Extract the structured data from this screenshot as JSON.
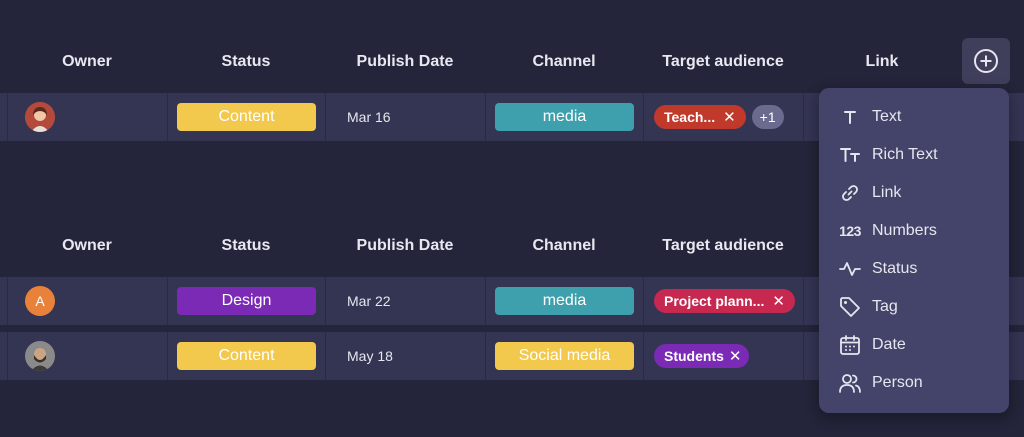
{
  "tables": [
    {
      "headers": [
        "Owner",
        "Status",
        "Publish Date",
        "Channel",
        "Target audience",
        "Link"
      ],
      "rows": [
        {
          "owner_avatar": "",
          "status": "Content",
          "publish_date": "Mar 16",
          "channel": "media",
          "audience_tag": "Teach...",
          "audience_more": "+1"
        }
      ]
    },
    {
      "headers": [
        "Owner",
        "Status",
        "Publish Date",
        "Channel",
        "Target audience"
      ],
      "rows": [
        {
          "owner_avatar": "A",
          "status": "Design",
          "publish_date": "Mar 22",
          "channel": "media",
          "audience_tag": "Project plann..."
        },
        {
          "owner_avatar": "",
          "status": "Content",
          "publish_date": "May 18",
          "channel": "Social media",
          "audience_tag": "Students"
        }
      ]
    }
  ],
  "tag_remove_glyph": "✕",
  "column_menu": {
    "items": [
      {
        "label": "Text",
        "icon": "text-icon"
      },
      {
        "label": "Rich Text",
        "icon": "rich-text-icon"
      },
      {
        "label": "Link",
        "icon": "link-icon"
      },
      {
        "label": "Numbers",
        "icon": "numbers-icon"
      },
      {
        "label": "Status",
        "icon": "status-icon"
      },
      {
        "label": "Tag",
        "icon": "tag-icon"
      },
      {
        "label": "Date",
        "icon": "calendar-icon"
      },
      {
        "label": "Person",
        "icon": "person-icon"
      }
    ]
  },
  "colors": {
    "background": "#24243a",
    "row": "#343453",
    "status_content": "#f2c94c",
    "status_design": "#7b2ab6",
    "channel_media": "#3ea0ad",
    "channel_social": "#f2c94c",
    "tag_teachers": "#c0392b",
    "tag_project": "#c62850",
    "tag_students": "#7b2ab6",
    "menu": "#44446a"
  }
}
